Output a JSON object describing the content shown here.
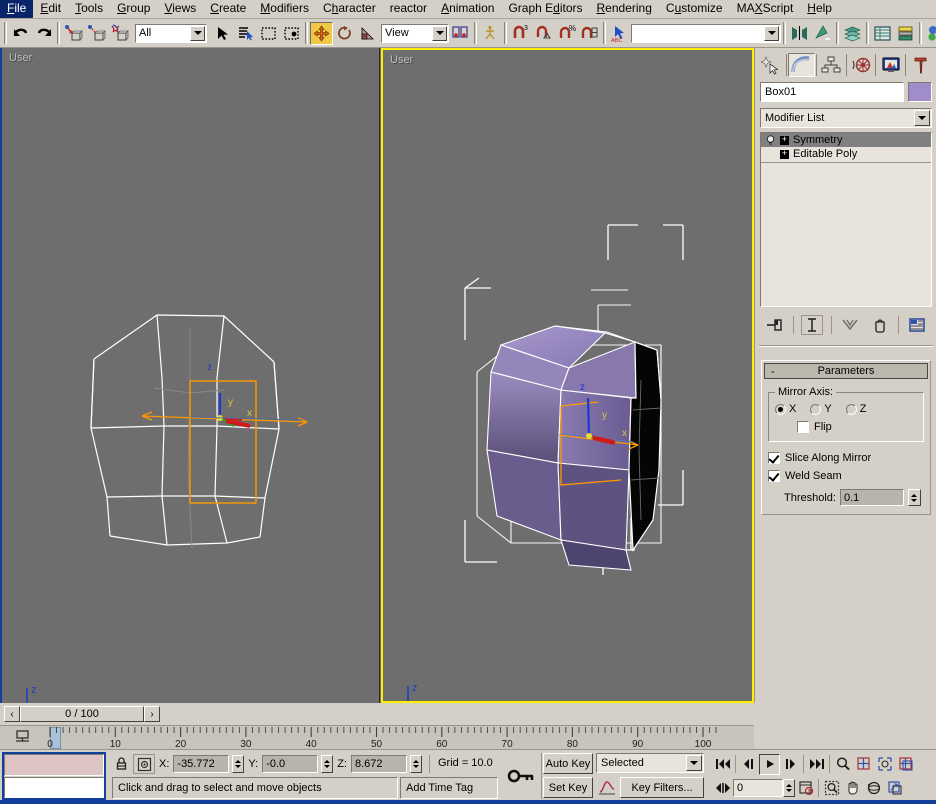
{
  "app": {
    "title": "3ds Max",
    "accent_blue": "#10409c",
    "panel_bg": "#d4d0c8",
    "viewport_bg": "#6e6e6e",
    "active_viewport_border": "#ffee00"
  },
  "menubar": {
    "items": [
      {
        "label": "File",
        "accel": "F"
      },
      {
        "label": "Edit",
        "accel": "E"
      },
      {
        "label": "Tools",
        "accel": "T"
      },
      {
        "label": "Group",
        "accel": "G"
      },
      {
        "label": "Views",
        "accel": "V"
      },
      {
        "label": "Create",
        "accel": "C"
      },
      {
        "label": "Modifiers",
        "accel": "M"
      },
      {
        "label": "Character",
        "accel": "h"
      },
      {
        "label": "reactor",
        "accel": ""
      },
      {
        "label": "Animation",
        "accel": "A"
      },
      {
        "label": "Graph Editors",
        "accel": "d"
      },
      {
        "label": "Rendering",
        "accel": "R"
      },
      {
        "label": "Customize",
        "accel": "u"
      },
      {
        "label": "MAXScript",
        "accel": "X"
      },
      {
        "label": "Help",
        "accel": "H"
      }
    ]
  },
  "toolbar": {
    "undo": "undo-arrow-icon",
    "redo": "redo-arrow-icon",
    "select_link": "select-and-link-icon",
    "unlink": "unlink-selection-icon",
    "bind_space_warp": "bind-to-space-warp-icon",
    "selection_filter_value": "All",
    "select_object": "select-object-arrow-icon",
    "select_by_name": "select-by-name-icon",
    "select_region_rect": "rectangular-selection-region-icon",
    "select_region_window": "window-crossing-icon",
    "select_move": "select-and-move-icon",
    "select_rotate": "select-and-rotate-icon",
    "select_scale": "select-and-uniform-scale-icon",
    "ref_coord_value": "View",
    "use_center": "use-pivot-point-center-icon",
    "select_manipulate": "select-and-manipulate-icon",
    "snap_3d": "snaps-toggle-3d-icon",
    "snap_angle": "angle-snap-toggle-icon",
    "snap_percent": "percent-snap-toggle-icon",
    "snap_spinner": "spinner-snap-toggle-icon",
    "named_select_sets_value": "",
    "mirror": "mirror-icon",
    "align": "align-icon",
    "layer_manager": "layer-manager-icon",
    "curve_editor": "curve-editor-icon",
    "schematic_view": "schematic-view-icon",
    "material_editor": "material-editor-icon",
    "render_scene": "render-scene-dialog-icon"
  },
  "viewports": [
    {
      "label": "User",
      "active": false,
      "shading": "wireframe",
      "axis_tripod": {
        "z": "z",
        "y": "y",
        "x": "x"
      }
    },
    {
      "label": "User",
      "active": true,
      "shading": "smooth-highlights",
      "axis_tripod": {
        "z": "z",
        "y": "y",
        "x": "x"
      }
    }
  ],
  "command_panel": {
    "tabs": [
      {
        "name": "create",
        "icon": "create-star-icon",
        "selected": false
      },
      {
        "name": "modify",
        "icon": "modify-arc-icon",
        "selected": true
      },
      {
        "name": "hierarchy",
        "icon": "hierarchy-icon",
        "selected": false
      },
      {
        "name": "motion",
        "icon": "motion-wheel-icon",
        "selected": false
      },
      {
        "name": "display",
        "icon": "display-monitor-icon",
        "selected": false
      },
      {
        "name": "utilities",
        "icon": "utilities-hammer-icon",
        "selected": false
      }
    ],
    "object_name": "Box01",
    "object_color": "#a08cc8",
    "modifier_list_label": "Modifier List",
    "stack": [
      {
        "label": "Symmetry",
        "selected": true,
        "has_lightbulb": true,
        "expandable": true
      },
      {
        "label": "Editable Poly",
        "selected": false,
        "has_lightbulb": false,
        "expandable": true
      }
    ],
    "stack_buttons": [
      {
        "name": "pin-stack",
        "icon": "pin-stack-icon"
      },
      {
        "name": "show-end-result",
        "icon": "show-end-result-icon",
        "pressed": true
      },
      {
        "name": "make-unique",
        "icon": "make-unique-icon"
      },
      {
        "name": "remove-modifier",
        "icon": "trash-icon"
      },
      {
        "name": "configure-modifier-sets",
        "icon": "configure-sets-icon"
      }
    ],
    "rollout": {
      "title": "Parameters",
      "collapse_glyph": "-",
      "mirror_axis_group": "Mirror Axis:",
      "axes": [
        {
          "label": "X",
          "selected": true
        },
        {
          "label": "Y",
          "selected": false
        },
        {
          "label": "Z",
          "selected": false
        }
      ],
      "flip": {
        "label": "Flip",
        "checked": false
      },
      "slice_along_mirror": {
        "label": "Slice Along Mirror",
        "checked": true
      },
      "weld_seam": {
        "label": "Weld Seam",
        "checked": true
      },
      "threshold": {
        "label": "Threshold:",
        "value": "0.1"
      }
    }
  },
  "time_slider": {
    "prev_glyph": "‹",
    "next_glyph": "›",
    "value": "0 / 100"
  },
  "track_bar": {
    "ticks_major": [
      0,
      10,
      20,
      30,
      40,
      50,
      60,
      70,
      80,
      90,
      100
    ],
    "current_frame": 0
  },
  "status": {
    "lock_icon": "selection-lock-toggle-icon",
    "abs_rel_icon": "absolute-relative-transform-icon",
    "x_label": "X:",
    "x_value": "-35.772",
    "y_label": "Y:",
    "y_value": "-0.0",
    "z_label": "Z:",
    "z_value": "8.672",
    "grid_label": "Grid = 10.0",
    "prompt": "Click and drag to select and move objects",
    "add_time_tag": "Add Time Tag"
  },
  "animation": {
    "key_mode_icon": "key-mode-toggle-icon",
    "auto_key": "Auto Key",
    "set_key": "Set Key",
    "selected_filter": "Selected",
    "curve_editor_icon": "parameter-curve-editor-icon",
    "key_filters": "Key Filters...",
    "playback": [
      {
        "name": "go-to-start",
        "glyph": "⏮"
      },
      {
        "name": "previous-frame",
        "glyph": "◁❙"
      },
      {
        "name": "play-animation",
        "glyph": "▶",
        "pressed": true
      },
      {
        "name": "next-frame",
        "glyph": "❙▷"
      },
      {
        "name": "go-to-end",
        "glyph": "⏭"
      }
    ],
    "current_frame_value": "0",
    "key_mode_toggle": "key-mode-toggle-icon",
    "time_config_icon": "time-configuration-icon"
  },
  "nav_controls": {
    "row1": [
      {
        "name": "zoom",
        "icon": "magnifier-icon"
      },
      {
        "name": "zoom-all",
        "icon": "zoom-all-icon"
      },
      {
        "name": "zoom-extents",
        "icon": "zoom-extents-icon"
      },
      {
        "name": "zoom-extents-all",
        "icon": "zoom-extents-all-icon"
      }
    ],
    "row2": [
      {
        "name": "region-zoom",
        "icon": "region-zoom-icon"
      },
      {
        "name": "pan-view",
        "icon": "hand-icon"
      },
      {
        "name": "arc-rotate",
        "icon": "arc-rotate-icon"
      },
      {
        "name": "min-max-toggle",
        "icon": "min-max-toggle-icon"
      }
    ]
  }
}
